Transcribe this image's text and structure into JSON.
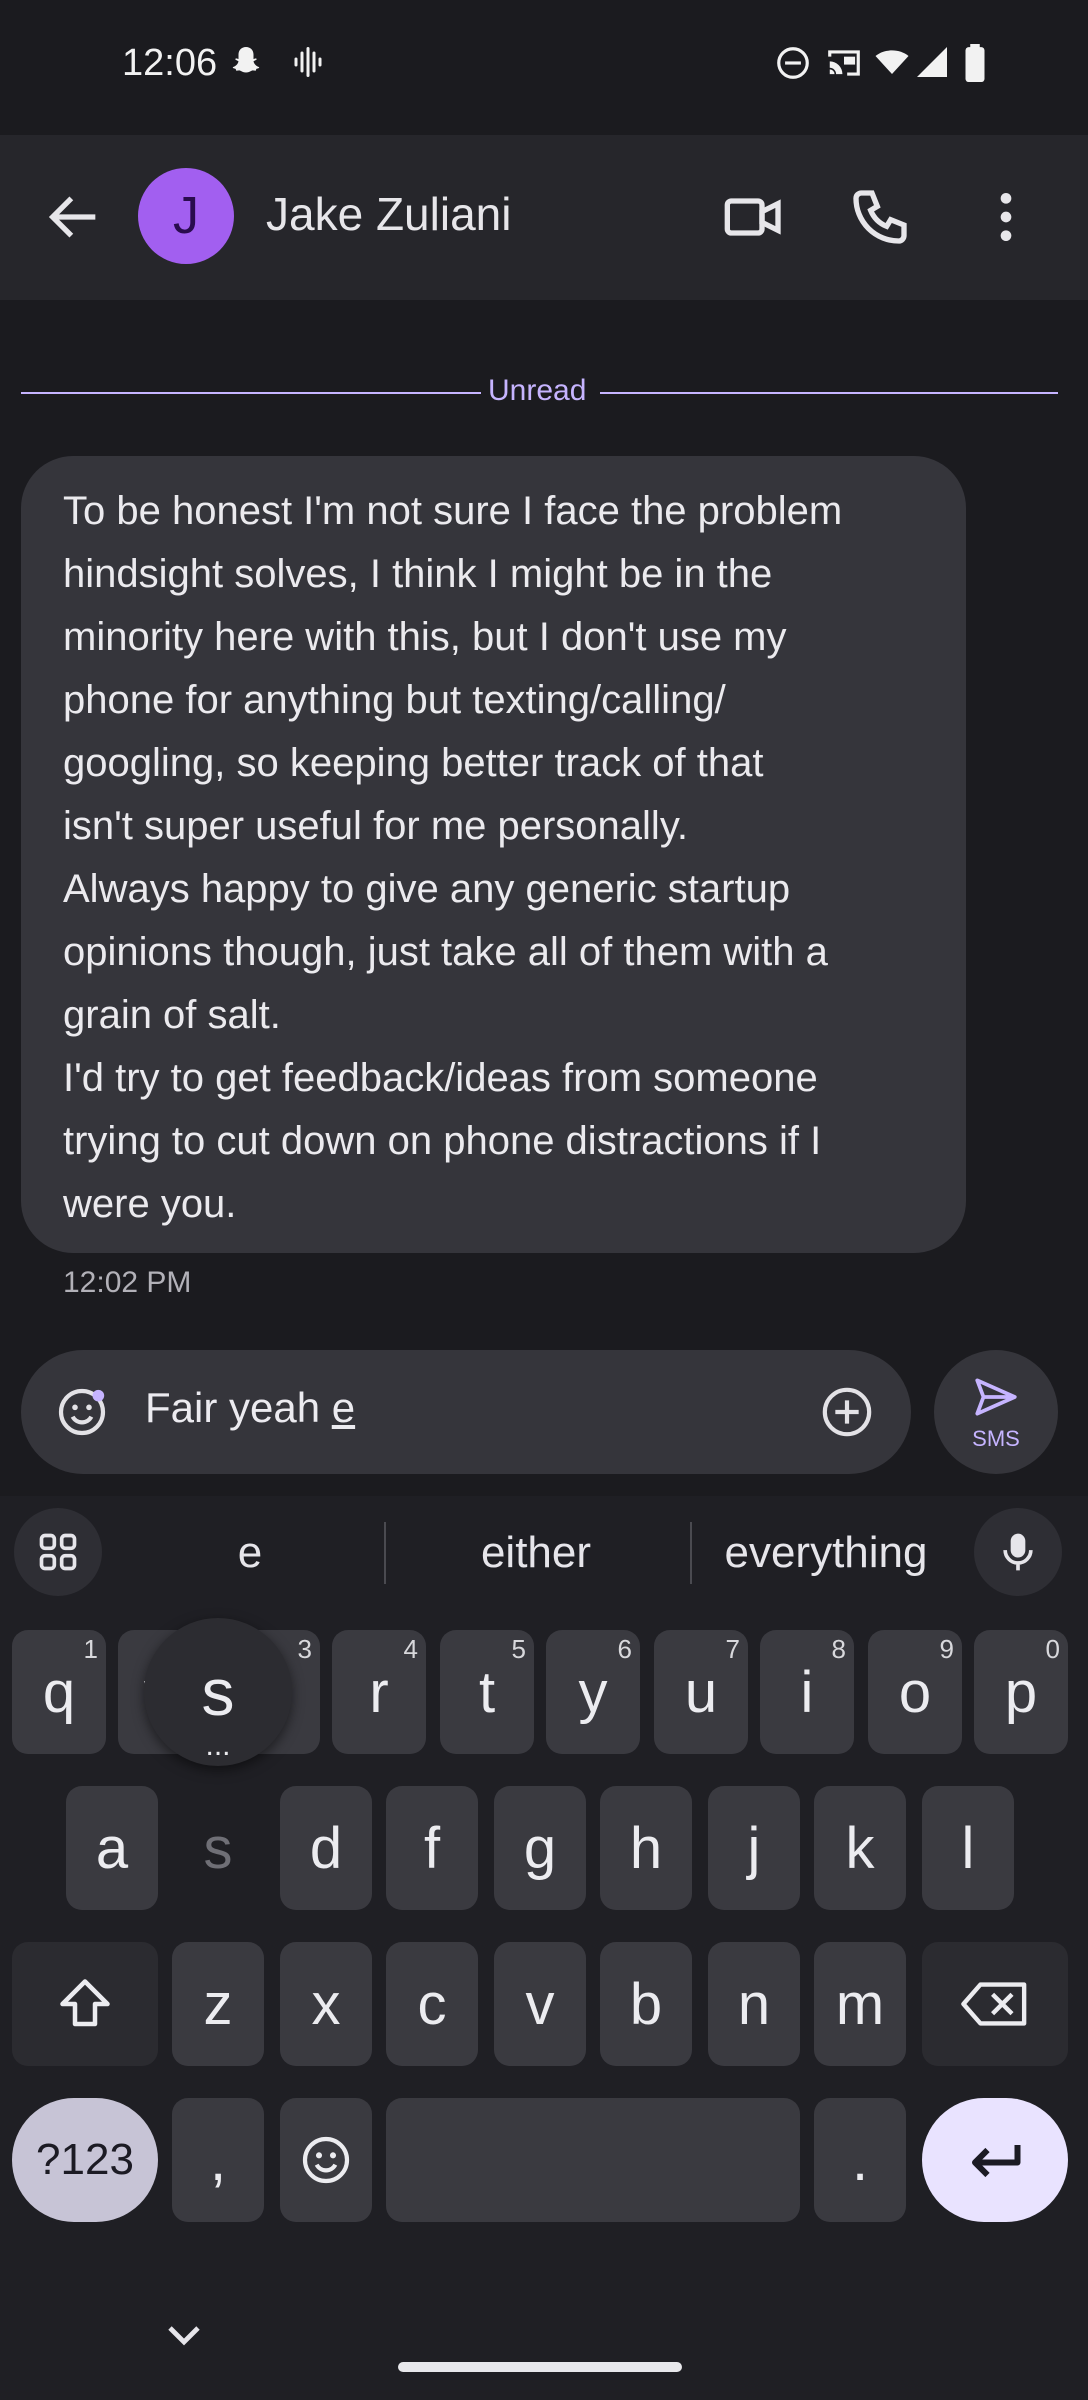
{
  "status_bar": {
    "time": "12:06",
    "left_icons": [
      "snapchat-icon",
      "voicemail-icon"
    ],
    "right_icons": [
      "do-not-disturb-icon",
      "cast-icon",
      "wifi-icon",
      "signal-icon",
      "battery-icon"
    ]
  },
  "app_bar": {
    "avatar_initial": "J",
    "contact_name": "Jake Zuliani",
    "avatar_color": "#a25ff0"
  },
  "conversation": {
    "unread_label": "Unread",
    "message_text": "To be honest I'm not sure I face the problem\nhindsight solves, I think I might be in the\nminority here with this, but I don't use my\nphone for anything but texting/calling/\ngoogling, so keeping better track of that\nisn't super useful for me personally.\nAlways happy to give any generic startup\nopinions though, just take all of them with a\ngrain of salt.\nI'd try to get feedback/ideas from someone\ntrying to cut down on phone distractions if I\nwere you.",
    "message_time": "12:02 PM"
  },
  "composer": {
    "text_prefix": "Fair yeah ",
    "text_composing": "e",
    "send_label": "SMS"
  },
  "keyboard": {
    "suggestions": [
      "e",
      "either",
      "everything"
    ],
    "row1": [
      {
        "label": "q",
        "hint": "1"
      },
      {
        "label": "w",
        "hint": "2"
      },
      {
        "label": "e",
        "hint": "3"
      },
      {
        "label": "r",
        "hint": "4"
      },
      {
        "label": "t",
        "hint": "5"
      },
      {
        "label": "y",
        "hint": "6"
      },
      {
        "label": "u",
        "hint": "7"
      },
      {
        "label": "i",
        "hint": "8"
      },
      {
        "label": "o",
        "hint": "9"
      },
      {
        "label": "p",
        "hint": "0"
      }
    ],
    "row2": [
      "a",
      "s",
      "d",
      "f",
      "g",
      "h",
      "j",
      "k",
      "l"
    ],
    "row3": [
      "z",
      "x",
      "c",
      "v",
      "b",
      "n",
      "m"
    ],
    "symbols_label": "?123",
    "comma_label": ",",
    "period_label": ".",
    "popup_key": "s",
    "popup_more": "...",
    "accent_color": "#c7c4d6",
    "enter_color": "#e9e3ff"
  }
}
